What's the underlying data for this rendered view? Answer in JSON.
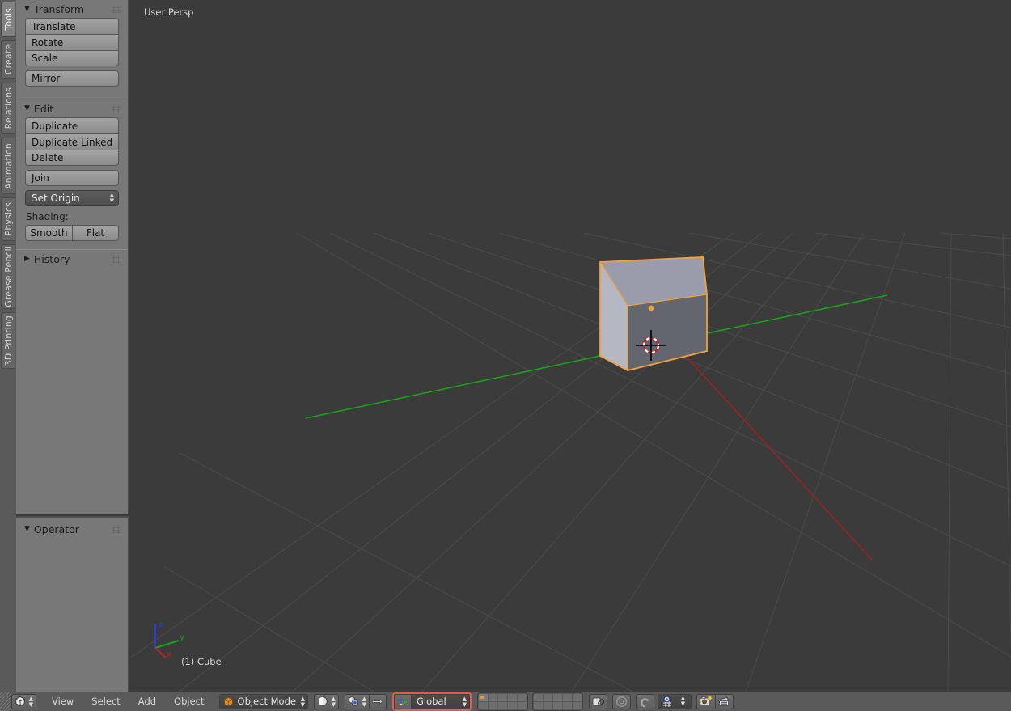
{
  "theme": {
    "viewport_bg": "#3b3b3b",
    "panel_bg": "#787878",
    "header_bg": "#5a5a5a",
    "accent_orange": "#e8a33d",
    "highlight_red": "#f4544a",
    "axis_x": "#9b2222",
    "axis_y": "#1aa11a",
    "axis_z": "#2b3fd6",
    "grid_line": "#4b4b4b"
  },
  "tabstrip": {
    "items": [
      {
        "label": "Tools",
        "active": true
      },
      {
        "label": "Create",
        "active": false
      },
      {
        "label": "Relations",
        "active": false
      },
      {
        "label": "Animation",
        "active": false
      },
      {
        "label": "Physics",
        "active": false
      },
      {
        "label": "Grease Pencil",
        "active": false
      },
      {
        "label": "3D Printing",
        "active": false
      }
    ]
  },
  "toolshelf": {
    "transform": {
      "title": "Transform",
      "collapsed": false,
      "buttons": [
        "Translate",
        "Rotate",
        "Scale"
      ],
      "mirror": "Mirror"
    },
    "edit": {
      "title": "Edit",
      "collapsed": false,
      "buttons": [
        "Duplicate",
        "Duplicate Linked",
        "Delete"
      ],
      "join": "Join",
      "set_origin": "Set Origin",
      "shading_label": "Shading:",
      "shading_options": [
        "Smooth",
        "Flat"
      ]
    },
    "history": {
      "title": "History",
      "collapsed": true
    }
  },
  "operator": {
    "title": "Operator",
    "collapsed": false
  },
  "viewport": {
    "persp_label": "User Persp",
    "object_label": "(1) Cube",
    "axis_gizmo": {
      "z": "z",
      "y": "y",
      "x": "x"
    }
  },
  "bottombar": {
    "editor_type_icon": "cube-icon",
    "menus": [
      "View",
      "Select",
      "Add",
      "Object"
    ],
    "mode": {
      "label": "Object Mode",
      "icon": "object-mode-cube-icon"
    },
    "viewport_shading_icon": "solid-shade-sphere-icon",
    "scene_render_icon": "render-spheres-icon",
    "render_toggle_icon": "arrows-swap-icon",
    "pivot_icon": "pivot-center-icon",
    "orientation": {
      "label": "Global",
      "icon": "axis-gizmo-icon",
      "highlighted": true
    },
    "layers": {
      "group_a": {
        "top": [
          true,
          false,
          false,
          false,
          false
        ],
        "bottom": [
          false,
          false,
          false,
          false,
          false
        ]
      },
      "group_b": {
        "top": [
          false,
          false,
          false,
          false,
          false
        ],
        "bottom": [
          false,
          false,
          false,
          false,
          false
        ]
      }
    },
    "right_icons": [
      "lock-object-modes-icon",
      "proportional-edit-icon",
      "snap-magnet-icon",
      "snap-target-grid-icon",
      "render-camera-icon",
      "render-animation-icon"
    ]
  }
}
